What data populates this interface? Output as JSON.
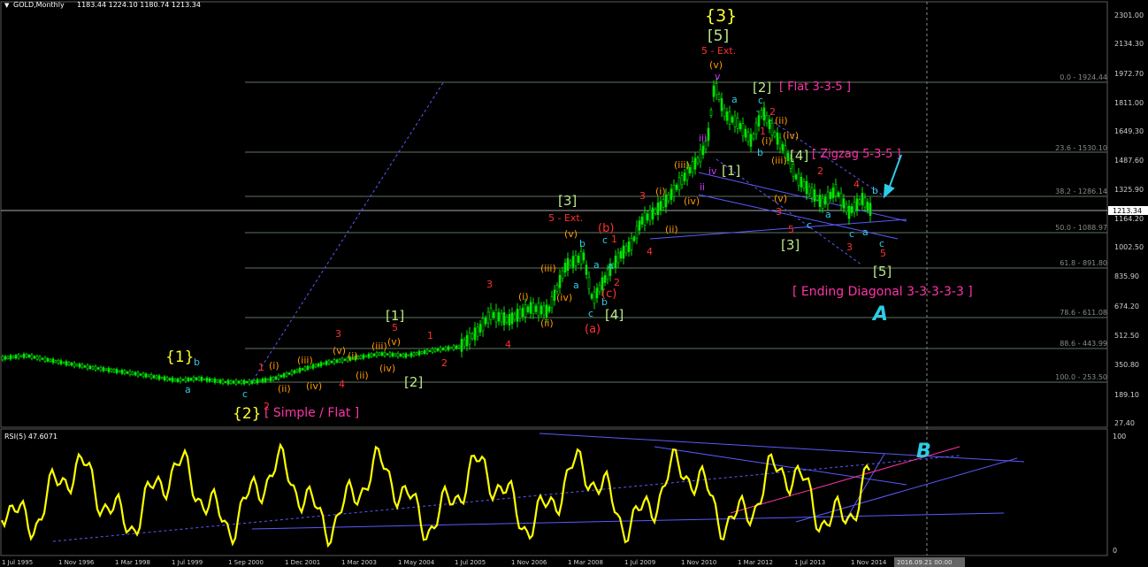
{
  "header": {
    "arrow": "▼",
    "symbol": "GOLD,Monthly",
    "ohlc": "1183.44 1224.10 1180.74 1213.34"
  },
  "rsi": {
    "label": "RSI(5) 47.6071",
    "scale_top": "100",
    "scale_bottom": "0"
  },
  "price_axis": {
    "labels": [
      "2301.00",
      "2134.30",
      "1972.70",
      "1811.00",
      "1649.30",
      "1487.60",
      "1325.90",
      "1164.20",
      "1002.50",
      "835.90",
      "674.20",
      "512.50",
      "350.80",
      "189.10",
      "27.40"
    ],
    "current_price": "1213.34"
  },
  "fib_levels": [
    "0.0 - 1924.44",
    "23.6 - 1530.10",
    "38.2 - 1286.14",
    "50.0 - 1088.97",
    "61.8 - 891.80",
    "78.6 - 611.08",
    "88.6 - 443.99",
    "100.0 - 253.50"
  ],
  "time_axis": {
    "labels": [
      "1 Jul 1995",
      "1 Nov 1996",
      "1 Mar 1998",
      "1 Jul 1999",
      "1 Sep 2000",
      "1 Dec 2001",
      "1 Mar 2003",
      "1 May 2004",
      "1 Jul 2005",
      "1 Nov 2006",
      "1 Mar 2008",
      "1 Jul 2009",
      "1 Nov 2010",
      "1 Mar 2012",
      "1 Jul 2013",
      "1 Nov 2014"
    ],
    "cursor_date": "2016.09.21 00:00"
  },
  "annotations": {
    "wave3_top": "{3}",
    "wave5_top": "[5]",
    "ext_top": "5 - Ext.",
    "flat_title": "[ Flat 3-3-5 ]",
    "zigzag_title": "[ Zigzag 5-3-5 ]",
    "ending_diagonal": "[ Ending Diagonal 3-3-3-3-3 ]",
    "simple_flat": "[ Simple / Flat ]",
    "wave1_major": "{1}",
    "wave2_major": "{2}",
    "wave3_mid": "[3]",
    "ext_mid": "5 - Ext.",
    "wave4_mid": "[4]",
    "wave1_mid": "[1]",
    "wave2_mid": "[2]",
    "wave2_late": "[2]",
    "wave1_late": "[1]",
    "wave4_late": "[4]",
    "wave3_late": "[3]",
    "wave5_late": "[5]",
    "marker_A": "A",
    "marker_B": "B"
  },
  "colors": {
    "background": "#000000",
    "candles": "#00e600",
    "grid": "#7a8a7a",
    "rsi_line": "#ffff00",
    "trendline": "#6b6bff",
    "label_orange": "#ff9900",
    "label_red": "#ff3030",
    "label_yellow": "#ffff33",
    "label_green": "#b8e986",
    "label_cyan": "#2ecbe6",
    "label_magenta": "#ff33aa",
    "label_purple": "#cc33ff"
  }
}
